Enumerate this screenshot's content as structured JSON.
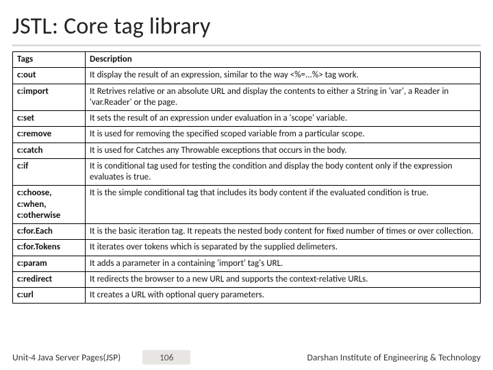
{
  "title": "JSTL: Core tag library",
  "table": {
    "header": {
      "col1": "Tags",
      "col2": "Description"
    },
    "rows": [
      {
        "tag": "c:out",
        "desc": "It display the result of an expression, similar to the way <%=...%> tag work."
      },
      {
        "tag": "c:import",
        "desc": "It Retrives relative or an absolute URL and display the contents to either a String in 'var', a Reader in 'var.Reader' or the page."
      },
      {
        "tag": "c:set",
        "desc": "It sets the result of an expression under evaluation in a 'scope' variable."
      },
      {
        "tag": "c:remove",
        "desc": "It is used for removing the specified scoped variable from a particular scope."
      },
      {
        "tag": "c:catch",
        "desc": "It is used for Catches any Throwable exceptions that occurs in the body."
      },
      {
        "tag": "c:if",
        "desc": "It is conditional tag used for testing the condition and display the body content only if the expression evaluates is true."
      },
      {
        "tag": "c:choose, c:when, c:otherwise",
        "desc": "It is the simple conditional tag that includes its body content if the evaluated condition is true."
      },
      {
        "tag": "c:for.Each",
        "desc": "It is the basic iteration tag. It repeats the nested body content for fixed number of times or over collection."
      },
      {
        "tag": "c:for.Tokens",
        "desc": "It iterates over tokens which is separated by the supplied delimeters."
      },
      {
        "tag": "c:param",
        "desc": "It adds a parameter in a containing 'import' tag's URL."
      },
      {
        "tag": "c:redirect",
        "desc": "It redirects the browser to a new URL and supports the context-relative URLs."
      },
      {
        "tag": "c:url",
        "desc": "It creates a URL with optional query parameters."
      }
    ]
  },
  "footer": {
    "left": "Unit-4 Java Server Pages(JSP)",
    "page": "106",
    "right": "Darshan Institute of Engineering & Technology"
  }
}
